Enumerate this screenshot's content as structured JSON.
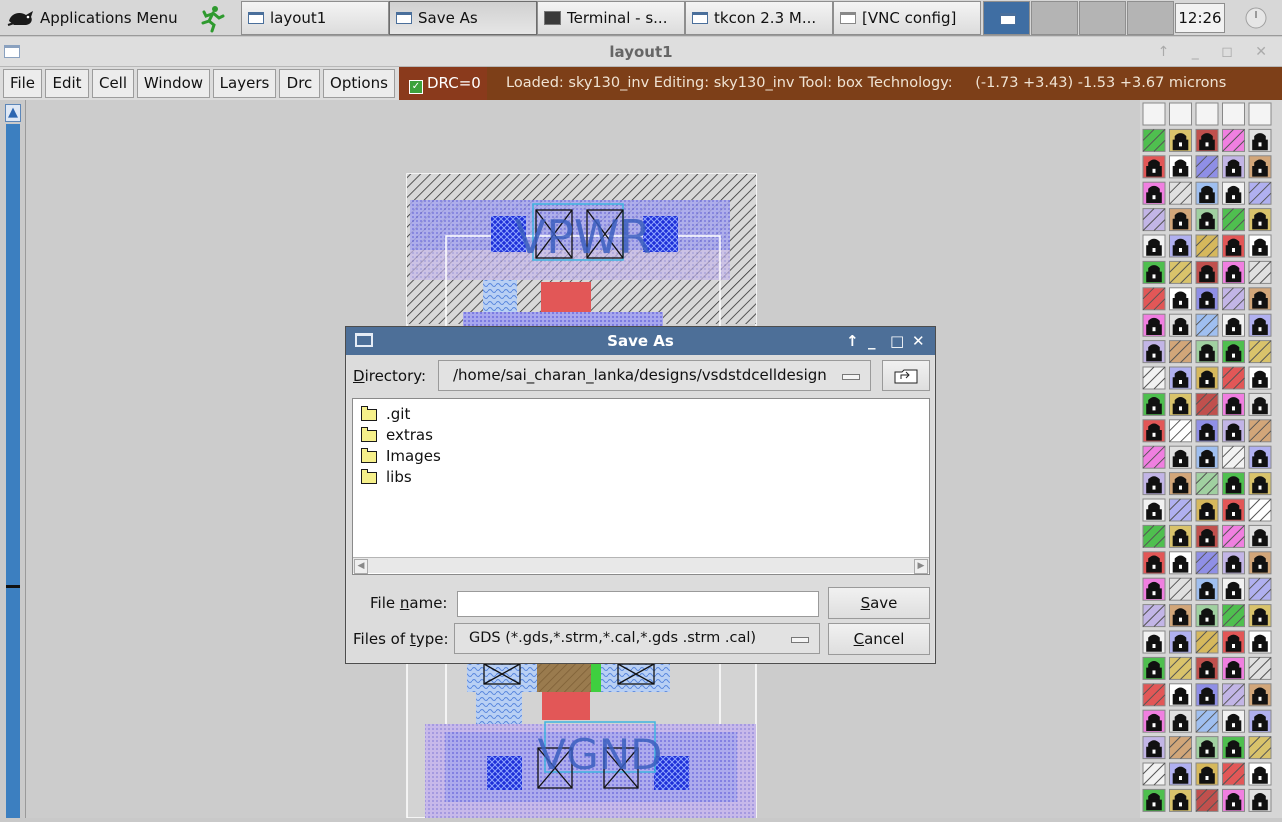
{
  "taskbar": {
    "apps_menu": "Applications Menu",
    "tasks": [
      {
        "label": "layout1"
      },
      {
        "label": "Save As"
      },
      {
        "label": "Terminal - s..."
      },
      {
        "label": "tkcon 2.3 M..."
      },
      {
        "label": "[VNC config]"
      }
    ],
    "clock": "12:26"
  },
  "main_window": {
    "title": "layout1",
    "menu": [
      "File",
      "Edit",
      "Cell",
      "Window",
      "Layers",
      "Drc",
      "Options"
    ],
    "drc_label": "DRC=0",
    "status": "Loaded: sky130_inv  Editing: sky130_inv  Tool: box   Technology:",
    "coords": "(-1.73 +3.43) -1.53 +3.67 microns"
  },
  "layout": {
    "labels": {
      "top": "VPWR",
      "bottom": "VGND"
    }
  },
  "dialog": {
    "title": "Save As",
    "directory_label": "Directory:",
    "directory_value": "/home/sai_charan_lanka/designs/vsdstdcelldesign",
    "files": [
      ".git",
      "extras",
      "Images",
      "libs"
    ],
    "filename_label": "File name:",
    "filename_value": "",
    "filetype_label": "Files of type:",
    "filetype_value": "GDS (*.gds,*.strm,*.cal,*.gds .strm .cal)",
    "save_label": "Save",
    "cancel_label": "Cancel"
  },
  "colors": {
    "titlebar": "#4d6f98",
    "status_bg": "#7d3f18",
    "drc_bg": "#8a3a1c",
    "locali": "#8f8fe6",
    "poly": "#e05050",
    "ndiff": "#3fcf3f",
    "pdiff": "#c79a70",
    "nwell": "#c2b5e6"
  }
}
